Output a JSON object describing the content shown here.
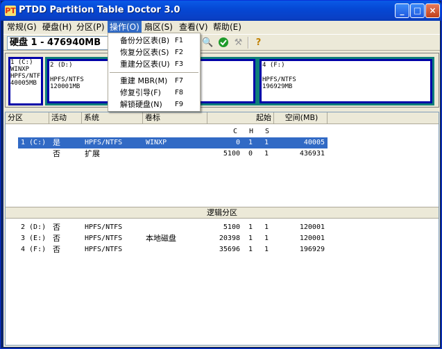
{
  "window": {
    "title": "PTDD Partition Table Doctor 3.0",
    "icon_text": "PT",
    "minimize": "_",
    "maximize": "□",
    "close": "×"
  },
  "menubar": [
    {
      "label": "常规(G)"
    },
    {
      "label": "硬盘(H)"
    },
    {
      "label": "分区(P)"
    },
    {
      "label": "操作(O)"
    },
    {
      "label": "扇区(S)"
    },
    {
      "label": "查看(V)"
    },
    {
      "label": "帮助(E)"
    }
  ],
  "toolbar": {
    "disk_label": "硬盘 1 - 476940MB",
    "icons": [
      "search-icon",
      "check-icon",
      "tool-icon",
      "help-icon"
    ]
  },
  "operations_menu": {
    "items": [
      {
        "label": "备份分区表(B)",
        "shortcut": "F1"
      },
      {
        "label": "恢复分区表(S)",
        "shortcut": "F2"
      },
      {
        "label": "重建分区表(U)",
        "shortcut": "F3"
      },
      {
        "label": "重建 MBR(M)",
        "shortcut": "F7"
      },
      {
        "label": "修复引导(F)",
        "shortcut": "F8"
      },
      {
        "label": "解锁硬盘(N)",
        "shortcut": "F9"
      }
    ]
  },
  "diskmap": {
    "p1": {
      "line1": "1 (C:)",
      "line2": "WINXP",
      "line3": "HPFS/NTF",
      "line4": "40005MB"
    },
    "p2": {
      "line1": "2 (D:)",
      "line2": "HPFS/NTFS",
      "line3": "120001MB"
    },
    "p4": {
      "line1": "4 (F:)",
      "line2": "HPFS/NTFS",
      "line3": "196929MB"
    }
  },
  "table": {
    "headers": {
      "partition": "分区",
      "active": "活动",
      "system": "系统",
      "label": "卷标",
      "start": "起始",
      "size": "空间(MB)"
    },
    "sub_headers": {
      "c": "C",
      "h": "H",
      "s": "S"
    },
    "primary_rows": [
      {
        "partition": "1 (C:)",
        "active": "是",
        "system": "HPFS/NTFS",
        "label": "WINXP",
        "c": "0",
        "h": "1",
        "s": "1",
        "size": "40005"
      },
      {
        "partition": "",
        "active": "否",
        "system": "扩展",
        "label": "",
        "c": "5100",
        "h": "0",
        "s": "1",
        "size": "436931"
      }
    ],
    "logical_header": "逻辑分区",
    "logical_rows": [
      {
        "partition": "2 (D:)",
        "active": "否",
        "system": "HPFS/NTFS",
        "label": "",
        "c": "5100",
        "h": "1",
        "s": "1",
        "size": "120001"
      },
      {
        "partition": "3 (E:)",
        "active": "否",
        "system": "HPFS/NTFS",
        "label": "本地磁盘",
        "c": "20398",
        "h": "1",
        "s": "1",
        "size": "120001"
      },
      {
        "partition": "4 (F:)",
        "active": "否",
        "system": "HPFS/NTFS",
        "label": "",
        "c": "35696",
        "h": "1",
        "s": "1",
        "size": "196929"
      }
    ]
  },
  "colors": {
    "titlebar": "#0548d5",
    "selection": "#316ac5",
    "partition_border": "#0000a8",
    "extended_fill": "#0f7f7a",
    "face": "#ece9d8"
  }
}
